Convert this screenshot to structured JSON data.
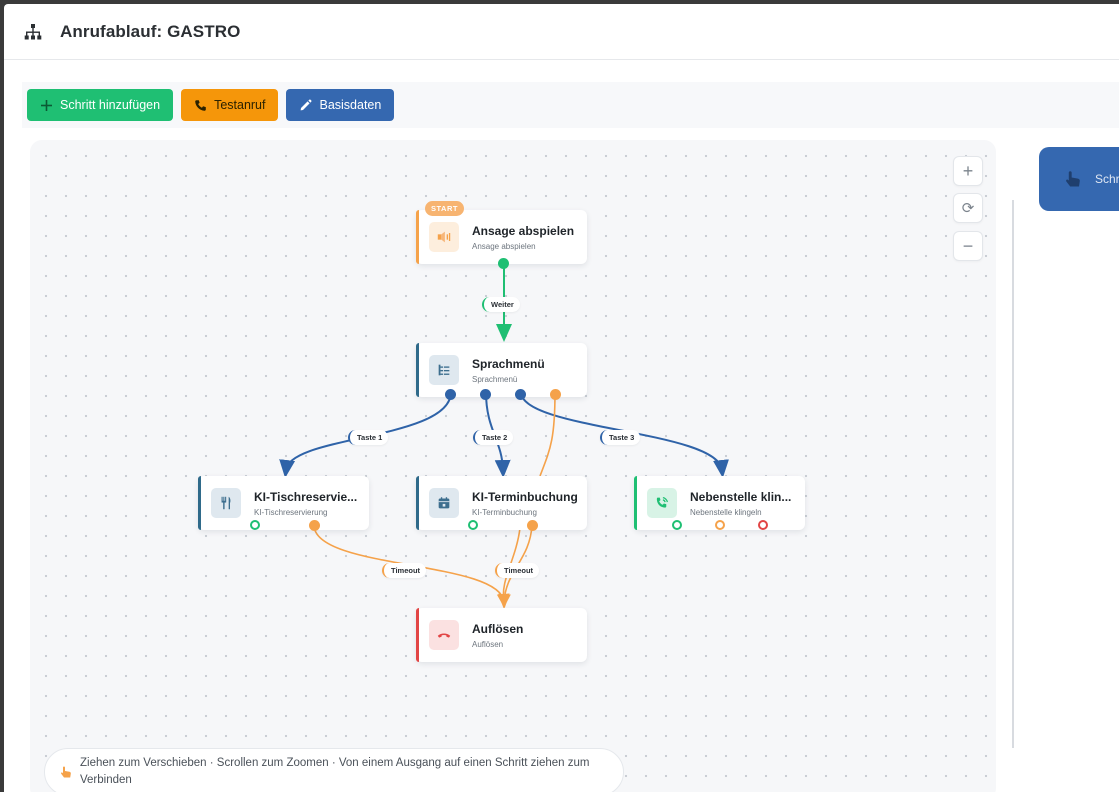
{
  "window": {
    "title": "Anrufablauf: GASTRO"
  },
  "toolbar": {
    "add_step": "Schritt hinzufügen",
    "test_call": "Testanruf",
    "base_data": "Basisdaten"
  },
  "zoom": {
    "in": "+",
    "reset": "⟳",
    "out": "−"
  },
  "nodes": {
    "announce": {
      "badge": "START",
      "title": "Ansage abspielen",
      "subtitle": "Ansage abspielen",
      "color": "#f5a24a",
      "icon": "speaker-icon"
    },
    "voice_menu": {
      "title": "Sprachmenü",
      "subtitle": "Sprachmenü",
      "color": "#2f6a8a",
      "icon": "menu-list-icon"
    },
    "table_res": {
      "title": "KI-Tischreservie...",
      "subtitle": "KI-Tischreservierung",
      "color": "#2f6a8a",
      "icon": "cutlery-icon"
    },
    "appointment": {
      "title": "KI-Terminbuchung",
      "subtitle": "KI-Terminbuchung",
      "color": "#2f6a8a",
      "icon": "calendar-icon"
    },
    "extension": {
      "title": "Nebenstelle klin...",
      "subtitle": "Nebenstelle klingeln",
      "color": "#1fbf73",
      "icon": "phone-ring-icon"
    },
    "hangup": {
      "title": "Auflösen",
      "subtitle": "Auflösen",
      "color": "#e24545",
      "icon": "hangup-icon"
    }
  },
  "edges": {
    "weiter": "Weiter",
    "taste1": "Taste 1",
    "taste2": "Taste 2",
    "taste3": "Taste 3",
    "timeout1": "Timeout",
    "timeout2": "Timeout"
  },
  "hint": {
    "text": "Ziehen zum Verschieben · Scrollen zum Zoomen · Von einem Ausgang auf einen Schritt ziehen zum Verbinden"
  },
  "side_panel": {
    "label": "Schr"
  },
  "colors": {
    "green": "#1fbf73",
    "orange": "#f5960a",
    "blue": "#3568b0",
    "red": "#e24545"
  }
}
